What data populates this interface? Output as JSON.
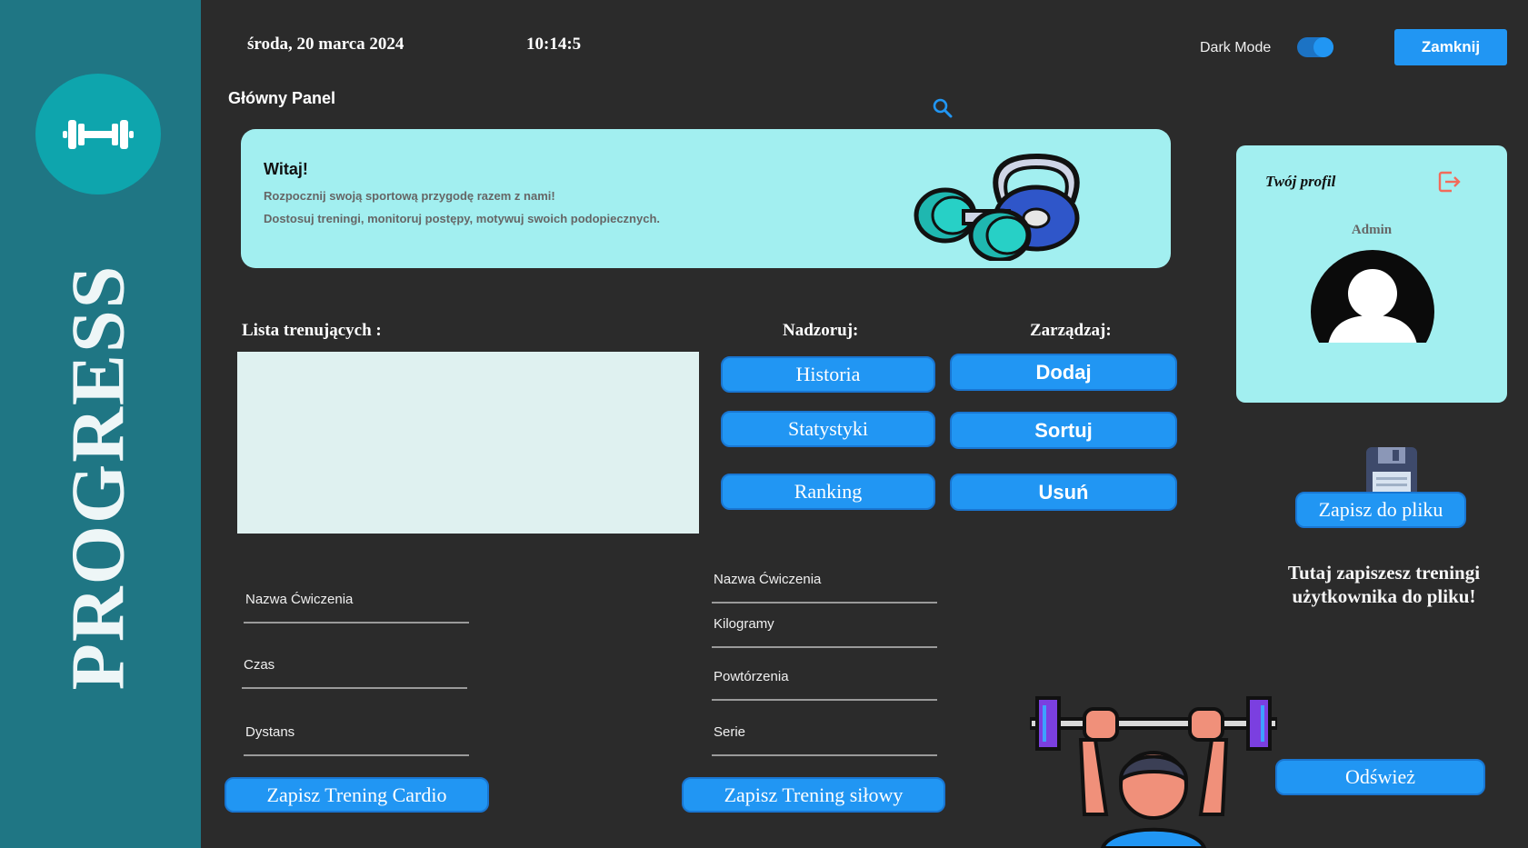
{
  "header": {
    "date": "środa, 20 marca 2024",
    "time": "10:14:5",
    "dark_mode_label": "Dark Mode",
    "dark_mode_on": true,
    "close_label": "Zamknij"
  },
  "sidebar": {
    "brand": "PROGRESS",
    "logo_icon": "dumbbell-icon"
  },
  "main": {
    "title": "Główny Panel",
    "search_icon": "search-icon",
    "welcome": {
      "title": "Witaj!",
      "line1": "Rozpocznij swoją sportową przygodę razem z nami!",
      "line2": "Dostosuj treningi, monitoruj postępy, motywuj swoich podopiecznych."
    },
    "trainees_label": "Lista trenujących :",
    "supervise_label": "Nadzoruj:",
    "manage_label": "Zarządzaj:",
    "supervise_buttons": [
      "Historia",
      "Statystyki",
      "Ranking"
    ],
    "manage_buttons": [
      "Dodaj",
      "Sortuj",
      "Usuń"
    ],
    "cardio_fields": [
      "Nazwa Ćwiczenia",
      "Czas",
      "Dystans"
    ],
    "strength_fields": [
      "Nazwa Ćwiczenia",
      "Kilogramy",
      "Powtórzenia",
      "Serie"
    ],
    "save_cardio": "Zapisz Trening Cardio",
    "save_strength": "Zapisz Trening siłowy"
  },
  "profile": {
    "title": "Twój profil",
    "username": "Admin",
    "logout_icon": "logout-icon",
    "avatar_icon": "user-avatar-icon"
  },
  "file": {
    "save_button": "Zapisz do pliku",
    "note_line1": "Tutaj zapiszesz treningi",
    "note_line2": "użytkownika do pliku!",
    "refresh_button": "Odśwież"
  },
  "colors": {
    "accent": "#2196f3",
    "sidebar": "#1f7684",
    "card": "#a2eff0",
    "background": "#2b2b2b"
  }
}
